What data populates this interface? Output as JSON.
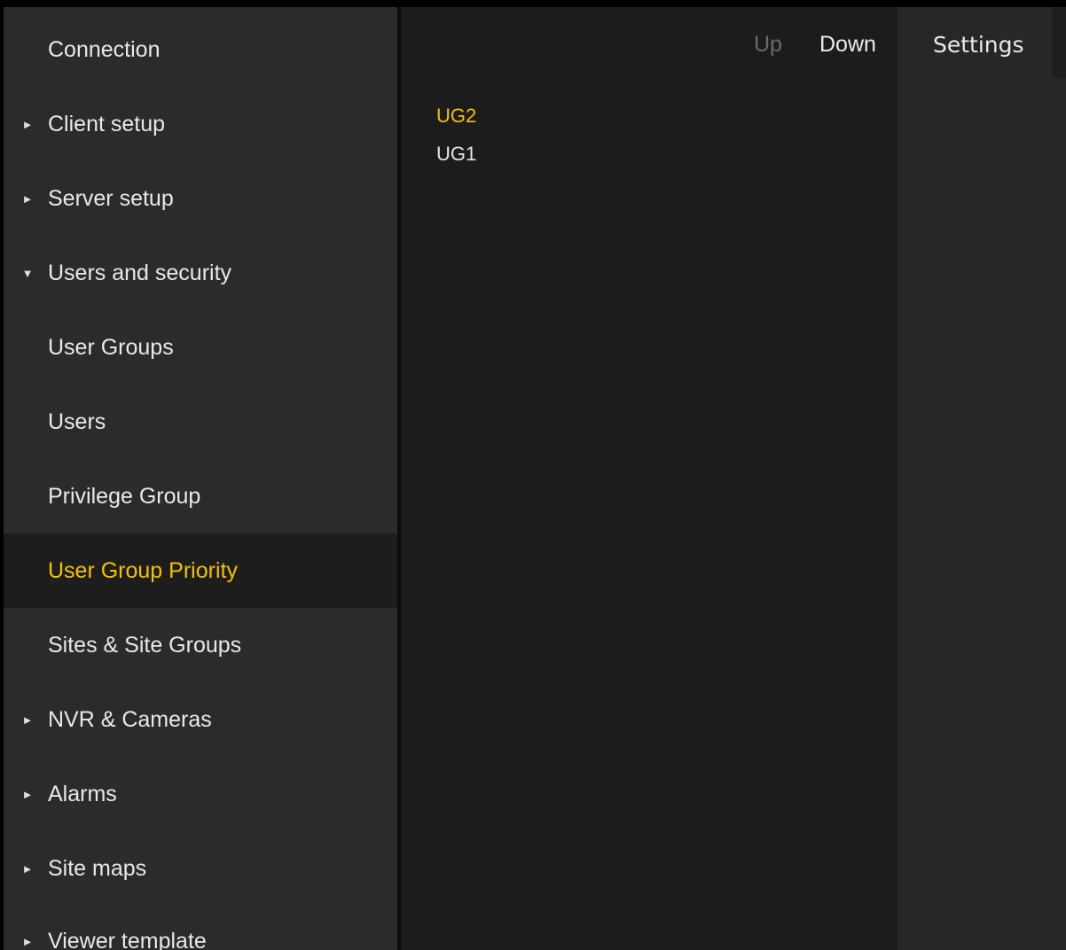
{
  "sidebar": {
    "items": [
      {
        "label": "Connection",
        "arrow": ""
      },
      {
        "label": "Client setup",
        "arrow": "►"
      },
      {
        "label": "Server setup",
        "arrow": "►"
      },
      {
        "label": "Users and security",
        "arrow": "▼"
      },
      {
        "label": "User Groups",
        "arrow": ""
      },
      {
        "label": "Users",
        "arrow": ""
      },
      {
        "label": "Privilege Group",
        "arrow": ""
      },
      {
        "label": "User Group Priority",
        "arrow": "",
        "selected": true
      },
      {
        "label": "Sites & Site Groups",
        "arrow": ""
      },
      {
        "label": "NVR & Cameras",
        "arrow": "►"
      },
      {
        "label": "Alarms",
        "arrow": "►"
      },
      {
        "label": "Site maps",
        "arrow": "►"
      },
      {
        "label": "Viewer template",
        "arrow": "►"
      }
    ]
  },
  "toolbar": {
    "up_label": "Up",
    "down_label": "Down"
  },
  "priority_list": {
    "items": [
      {
        "label": "UG2",
        "active": true
      },
      {
        "label": "UG1",
        "active": false
      }
    ]
  },
  "right_panel": {
    "settings_label": "Settings"
  },
  "colors": {
    "accent": "#f2c200",
    "sidebar_bg": "#2b2b2b",
    "main_bg": "#1c1c1c",
    "selected_bg": "#1d1d1d"
  }
}
